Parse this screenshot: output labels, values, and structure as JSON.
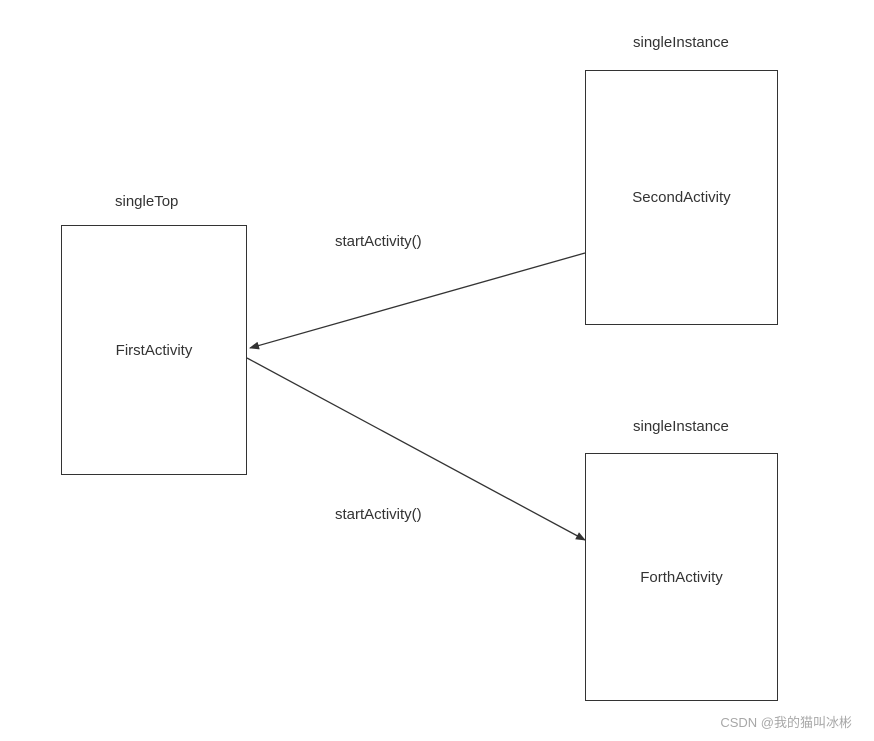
{
  "nodes": {
    "first": {
      "label": "FirstActivity",
      "mode": "singleTop"
    },
    "second": {
      "label": "SecondActivity",
      "mode": "singleInstance"
    },
    "forth": {
      "label": "ForthActivity",
      "mode": "singleInstance"
    }
  },
  "edges": {
    "secondToFirst": {
      "label": "startActivity()"
    },
    "firstToForth": {
      "label": "startActivity()"
    }
  },
  "watermark": "CSDN @我的猫叫冰彬"
}
